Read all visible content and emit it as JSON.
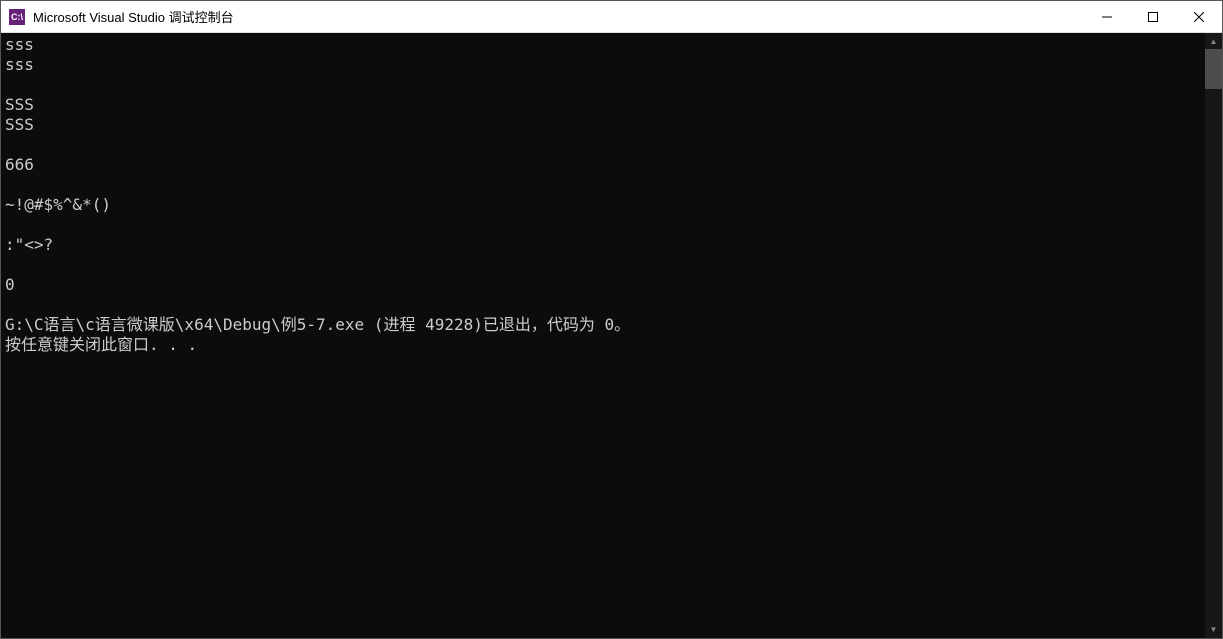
{
  "window": {
    "icon_text": "C:\\",
    "title": "Microsoft Visual Studio 调试控制台"
  },
  "console": {
    "lines": [
      "sss",
      "sss",
      "",
      "SSS",
      "SSS",
      "",
      "666",
      "",
      "~!@#$%^&*()",
      "",
      ":\"<>?",
      "",
      "0",
      "",
      "G:\\C语言\\c语言微课版\\x64\\Debug\\例5-7.exe (进程 49228)已退出，代码为 0。",
      "按任意键关闭此窗口. . ."
    ]
  }
}
